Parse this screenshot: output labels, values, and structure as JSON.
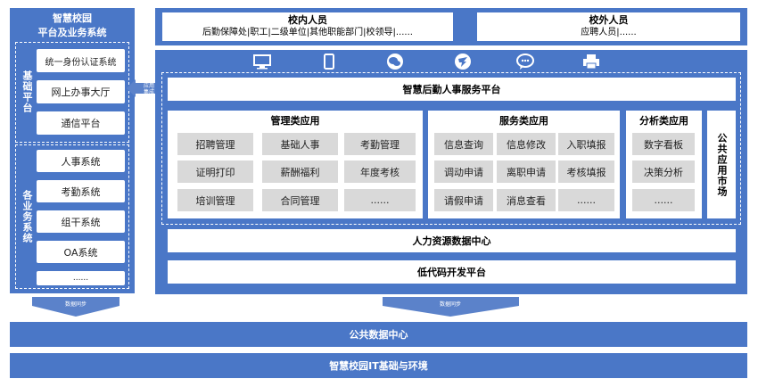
{
  "left_panel": {
    "title_line1": "智慧校园",
    "title_line2": "平台及业务系统",
    "basic_label": "基础平台",
    "basic_items": [
      "统一身份认证系统",
      "网上办事大厅",
      "通信平台"
    ],
    "business_label": "各业务系统",
    "business_items": [
      "人事系统",
      "考勤系统",
      "组干系统",
      "OA系统",
      "......"
    ]
  },
  "top_users": {
    "internal_title": "校内人员",
    "internal_desc": "后勤保障处|职工|二级单位|其他职能部门|校领导|......",
    "external_title": "校外人员",
    "external_desc": "应聘人员|......"
  },
  "icons": [
    "desktop-icon",
    "mobile-icon",
    "wechat-icon",
    "dingtalk-icon",
    "chat-icon",
    "printer-icon"
  ],
  "platform_title": "智慧后勤人事服务平台",
  "app_integration_tag_line1": "应用",
  "app_integration_tag_line2": "集成",
  "management": {
    "title": "管理类应用",
    "items": [
      "招聘管理",
      "基础人事",
      "考勤管理",
      "证明打印",
      "薪酬福利",
      "年度考核",
      "培训管理",
      "合同管理",
      "......"
    ]
  },
  "service": {
    "title": "服务类应用",
    "items": [
      "信息查询",
      "信息修改",
      "入职填报",
      "调动申请",
      "离职申请",
      "考核填报",
      "请假申请",
      "消息查看",
      "......"
    ]
  },
  "analysis": {
    "title": "分析类应用",
    "items": [
      "数字看板",
      "决策分析",
      "......"
    ]
  },
  "public_market": "公共应用市场",
  "hr_data_center": "人力资源数据中心",
  "lowcode_platform": "低代码开发平台",
  "sync_label_left": "数据同步",
  "sync_label_right": "数据同步",
  "public_data_center": "公共数据中心",
  "it_infrastructure": "智慧校园IT基础与环境"
}
